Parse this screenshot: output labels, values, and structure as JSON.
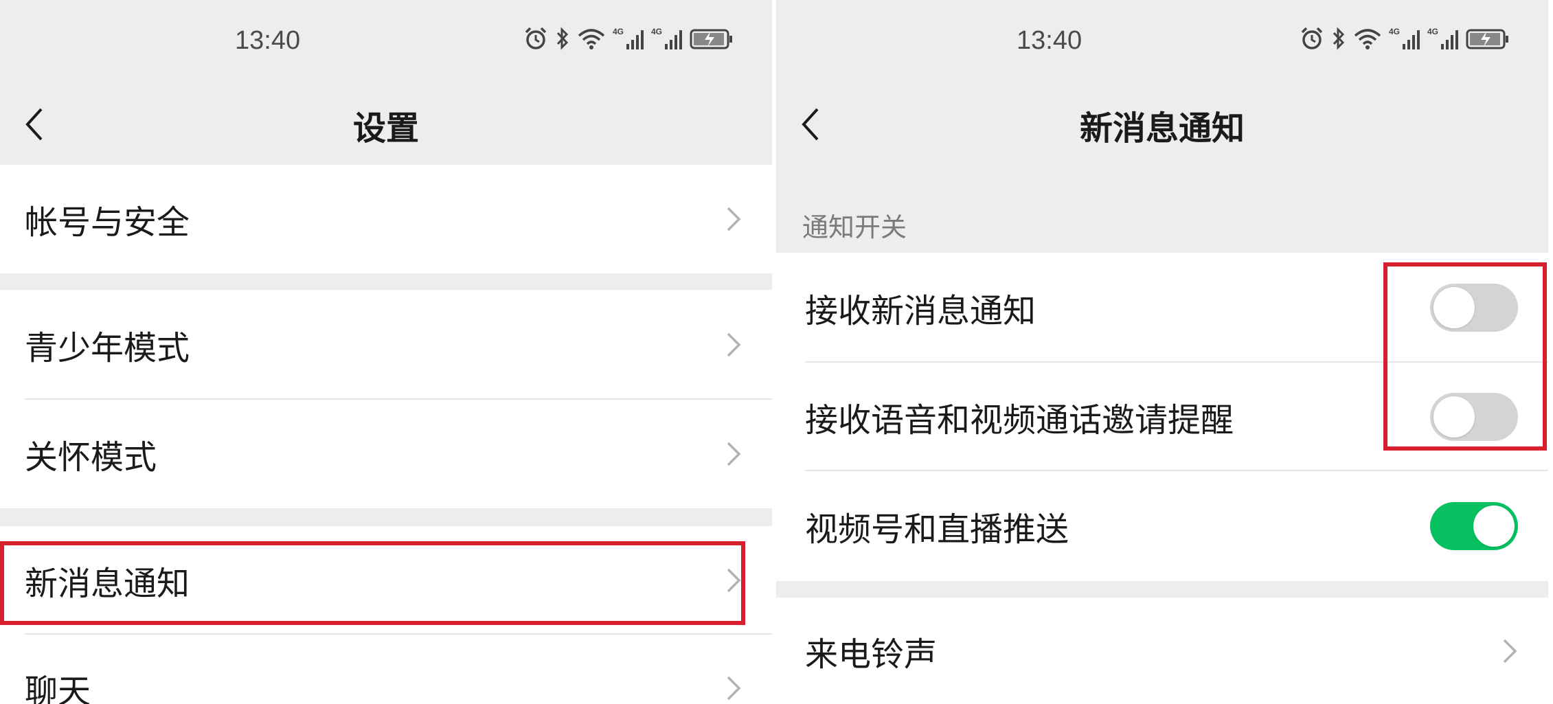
{
  "colors": {
    "background": "#ededed",
    "surface": "#ffffff",
    "highlight": "#d7202d",
    "toggle_on": "#07c160",
    "toggle_off": "#d4d4d4"
  },
  "left": {
    "status_bar": {
      "time": "13:40",
      "icons": [
        "alarm-icon",
        "bluetooth-icon",
        "wifi-icon",
        "4g-signal-icon",
        "4g-signal-icon",
        "battery-charging-icon"
      ]
    },
    "title": "设置",
    "items": [
      {
        "label": "帐号与安全"
      },
      {
        "label": "青少年模式"
      },
      {
        "label": "关怀模式"
      },
      {
        "label": "新消息通知",
        "highlighted": true
      },
      {
        "label": "聊天"
      }
    ]
  },
  "right": {
    "status_bar": {
      "time": "13:40",
      "icons": [
        "alarm-icon",
        "bluetooth-icon",
        "wifi-icon",
        "4g-signal-icon",
        "4g-signal-icon",
        "battery-charging-icon"
      ]
    },
    "title": "新消息通知",
    "section_label": "通知开关",
    "toggles": [
      {
        "label": "接收新消息通知",
        "on": false,
        "highlighted": true
      },
      {
        "label": "接收语音和视频通话邀请提醒",
        "on": false,
        "highlighted": true
      },
      {
        "label": "视频号和直播推送",
        "on": true
      }
    ],
    "items": [
      {
        "label": "来电铃声"
      }
    ]
  }
}
